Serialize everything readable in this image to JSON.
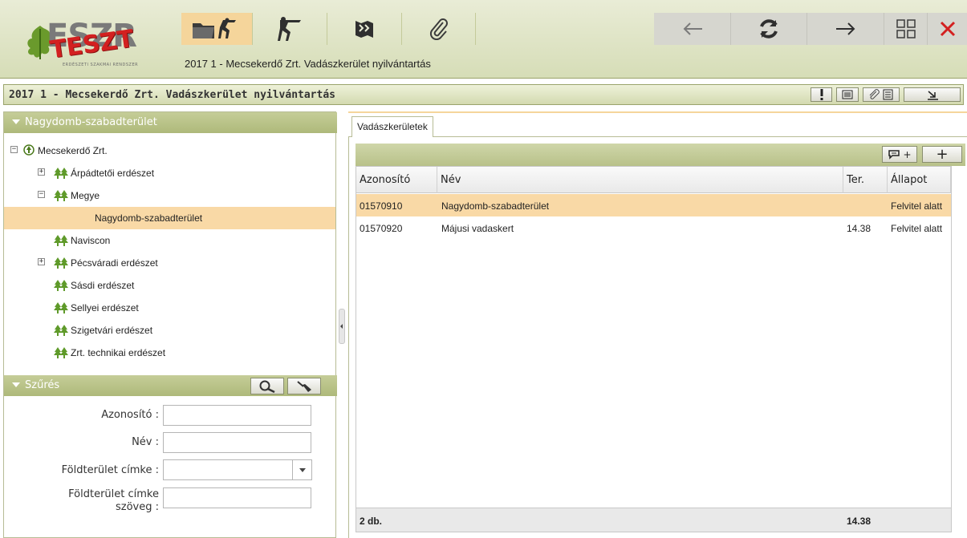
{
  "header": {
    "app_title": "2017 1 - Mecsekerdő Zrt. Vadászkerület nyilvántartás",
    "logo_main": "ESZR",
    "logo_stamp": "TESZT",
    "logo_sub": "ERDÉSZETI SZAKMAI RENDSZER",
    "toolbar_icons": [
      "folder-hunter-icon",
      "hunter-icon",
      "map-icon",
      "paperclip-icon",
      "back-arrow-icon",
      "refresh-icon",
      "forward-arrow-icon",
      "grid-icon",
      "close-icon"
    ],
    "colors": {
      "active": "#f5d59b",
      "close": "#d32020",
      "header_bg": "#dfe4c5"
    }
  },
  "titlebar": {
    "title": "2017 1 - Mecsekerdő Zrt. Vadászkerület nyilvántartás",
    "buttons": [
      "exclamation-icon",
      "document-icon",
      "attachment-document-icon",
      "collapse-icon"
    ]
  },
  "tree_panel": {
    "title": "Nagydomb-szabadterület",
    "nodes": [
      {
        "label": "Mecsekerdő Zrt.",
        "expander": "−"
      },
      {
        "label": "Árpádtetői erdészet",
        "expander": "+"
      },
      {
        "label": "Megye",
        "expander": "−"
      },
      {
        "label": "Nagydomb-szabadterület",
        "expander": ""
      },
      {
        "label": "Naviscon",
        "expander": ""
      },
      {
        "label": "Pécsváradi erdészet",
        "expander": "+"
      },
      {
        "label": "Sásdi erdészet",
        "expander": ""
      },
      {
        "label": "Sellyei erdészet",
        "expander": ""
      },
      {
        "label": "Szigetvári erdészet",
        "expander": ""
      },
      {
        "label": "Zrt. technikai erdészet",
        "expander": ""
      }
    ]
  },
  "filter": {
    "title": "Szűrés",
    "fields": {
      "azonosito": {
        "label": "Azonosító :",
        "value": ""
      },
      "nev": {
        "label": "Név :",
        "value": ""
      },
      "cimke": {
        "label": "Földterület címke :",
        "value": ""
      },
      "cimke_szoveg": {
        "label_1": "Földterület címke",
        "label_2": "szöveg :",
        "value": ""
      }
    }
  },
  "main": {
    "tab": "Vadászkerületek",
    "grid": {
      "columns": [
        "Azonosító",
        "Név",
        "Ter.",
        "Állapot"
      ],
      "rows": [
        {
          "id": "01570910",
          "name": "Nagydomb-szabadterület",
          "area": "",
          "status": "Felvitel alatt"
        },
        {
          "id": "01570920",
          "name": "Májusi vadaskert",
          "area": "14.38",
          "status": "Felvitel alatt"
        }
      ],
      "footer": {
        "count": "2 db.",
        "total_area": "14.38"
      },
      "toolbar": {
        "comment_add_label": "+",
        "add_label": "+"
      }
    }
  }
}
